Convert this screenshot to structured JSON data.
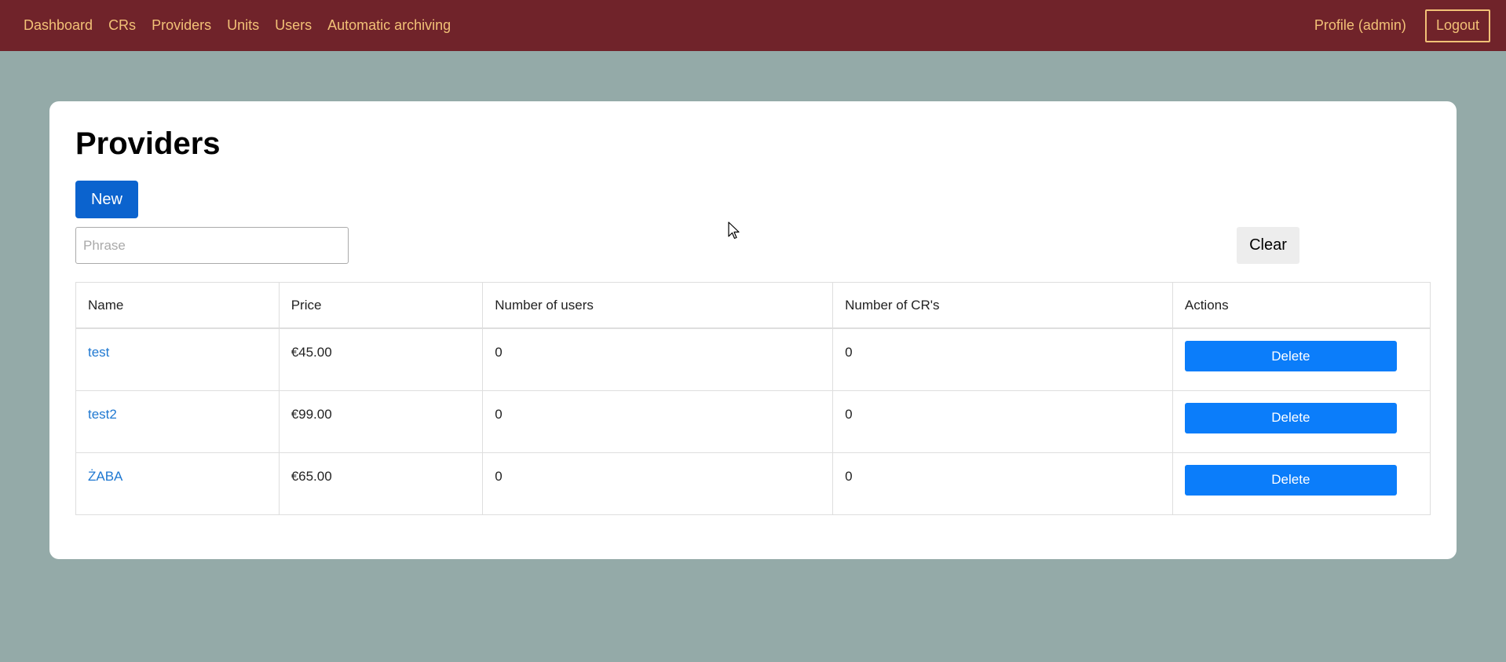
{
  "nav": {
    "links": [
      "Dashboard",
      "CRs",
      "Providers",
      "Units",
      "Users",
      "Automatic archiving"
    ],
    "profile": "Profile (admin)",
    "logout": "Logout"
  },
  "page": {
    "title": "Providers",
    "new_label": "New",
    "search_placeholder": "Phrase",
    "search_value": "",
    "clear_label": "Clear"
  },
  "table": {
    "headers": [
      "Name",
      "Price",
      "Number of users",
      "Number of CR's",
      "Actions"
    ],
    "rows": [
      {
        "name": "test",
        "price": "€45.00",
        "users": "0",
        "crs": "0",
        "action": "Delete"
      },
      {
        "name": "test2",
        "price": "€99.00",
        "users": "0",
        "crs": "0",
        "action": "Delete"
      },
      {
        "name": "ŻABA",
        "price": "€65.00",
        "users": "0",
        "crs": "0",
        "action": "Delete"
      }
    ]
  },
  "colors": {
    "navbar": "#70232a",
    "nav_text": "#f2c177",
    "background": "#94aaa8",
    "primary_button": "#0b63ce",
    "delete_button": "#0b7dfa",
    "link": "#1f78d1"
  },
  "icons": {
    "cursor": "mouse-pointer-icon"
  }
}
